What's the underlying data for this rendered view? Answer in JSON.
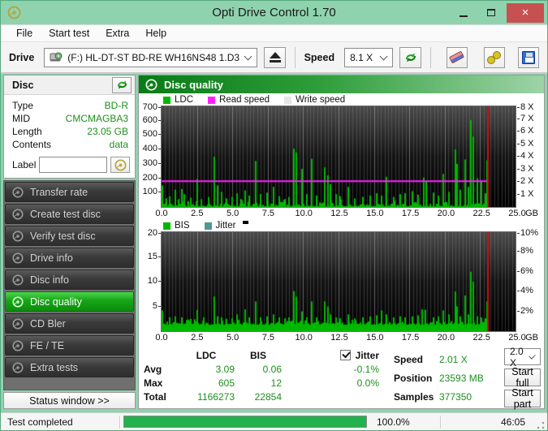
{
  "window": {
    "title": "Opti Drive Control 1.70",
    "close_glyph": "×"
  },
  "menu": {
    "items": [
      {
        "label": "File"
      },
      {
        "label": "Start test"
      },
      {
        "label": "Extra"
      },
      {
        "label": "Help"
      }
    ]
  },
  "toolbar": {
    "drive_label": "Drive",
    "drive_value": "(F:)  HL-DT-ST BD-RE  WH16NS48 1.D3",
    "speed_label": "Speed",
    "speed_value": "8.1 X"
  },
  "disc_panel": {
    "title": "Disc",
    "rows": [
      {
        "label": "Type",
        "value": "BD-R"
      },
      {
        "label": "MID",
        "value": "CMCMAGBA3"
      },
      {
        "label": "Length",
        "value": "23.05 GB"
      },
      {
        "label": "Contents",
        "value": "data"
      }
    ],
    "label_field": {
      "label": "Label",
      "value": ""
    }
  },
  "sidebar": {
    "buttons": [
      {
        "label": "Transfer rate"
      },
      {
        "label": "Create test disc"
      },
      {
        "label": "Verify test disc"
      },
      {
        "label": "Drive info"
      },
      {
        "label": "Disc info"
      },
      {
        "label": "Disc quality",
        "active": true
      },
      {
        "label": "CD Bler"
      },
      {
        "label": "FE / TE"
      },
      {
        "label": "Extra tests"
      }
    ],
    "status_window_label": "Status window >>"
  },
  "main": {
    "header": "Disc quality"
  },
  "chart_data": [
    {
      "type": "bar",
      "title": "Disc quality - LDC",
      "legend": [
        "LDC",
        "Read speed",
        "Write speed"
      ],
      "legend_colors": [
        "#00b800",
        "#ff22ff",
        "#e6e6e6"
      ],
      "xlim": [
        0,
        25
      ],
      "x_ticks": [
        "0.0",
        "2.5",
        "5.0",
        "7.5",
        "10.0",
        "12.5",
        "15.0",
        "17.5",
        "20.0",
        "22.5",
        "25.0"
      ],
      "x_unit": "GB",
      "ylim_left": [
        0,
        700
      ],
      "y_ticks_left": [
        "700",
        "600",
        "500",
        "400",
        "300",
        "200",
        "100"
      ],
      "ylim_right": [
        0,
        8
      ],
      "y_ticks_right": [
        "8 X",
        "7 X",
        "6 X",
        "5 X",
        "4 X",
        "3 X",
        "2 X",
        "1 X"
      ],
      "grid_step_gb": 0.25,
      "read_speed_x": 2.05,
      "marker_gb": 23.05,
      "data_end_gb": 23.05,
      "noise": {
        "base": 3,
        "max": 55,
        "seed": 11
      },
      "spikes": [
        [
          0.08,
          150
        ],
        [
          0.35,
          60
        ],
        [
          0.55,
          75
        ],
        [
          0.95,
          120
        ],
        [
          1.2,
          55
        ],
        [
          1.45,
          125
        ],
        [
          1.6,
          90
        ],
        [
          2.05,
          65
        ],
        [
          2.55,
          195
        ],
        [
          2.8,
          55
        ],
        [
          3.3,
          70
        ],
        [
          3.75,
          350
        ],
        [
          3.95,
          150
        ],
        [
          4.25,
          105
        ],
        [
          4.6,
          60
        ],
        [
          5.0,
          70
        ],
        [
          5.35,
          95
        ],
        [
          5.6,
          55
        ],
        [
          5.9,
          115
        ],
        [
          6.2,
          80
        ],
        [
          6.65,
          320
        ],
        [
          7.0,
          90
        ],
        [
          7.45,
          100
        ],
        [
          7.9,
          140
        ],
        [
          8.3,
          75
        ],
        [
          8.7,
          55
        ],
        [
          9.0,
          70
        ],
        [
          9.35,
          405
        ],
        [
          9.5,
          380
        ],
        [
          9.9,
          265
        ],
        [
          10.25,
          90
        ],
        [
          10.6,
          335
        ],
        [
          10.95,
          80
        ],
        [
          11.55,
          275
        ],
        [
          11.75,
          220
        ],
        [
          11.95,
          160
        ],
        [
          12.3,
          90
        ],
        [
          12.6,
          75
        ],
        [
          13.2,
          140
        ],
        [
          13.65,
          60
        ],
        [
          14.2,
          70
        ],
        [
          14.75,
          80
        ],
        [
          15.2,
          95
        ],
        [
          15.55,
          80
        ],
        [
          15.9,
          210
        ],
        [
          16.4,
          70
        ],
        [
          16.85,
          90
        ],
        [
          17.2,
          95
        ],
        [
          17.7,
          110
        ],
        [
          18.1,
          85
        ],
        [
          18.5,
          205
        ],
        [
          18.7,
          180
        ],
        [
          19.2,
          100
        ],
        [
          19.55,
          80
        ],
        [
          19.9,
          230
        ],
        [
          20.3,
          105
        ],
        [
          20.75,
          400
        ],
        [
          20.9,
          300
        ],
        [
          21.1,
          120
        ],
        [
          21.45,
          330
        ],
        [
          21.7,
          140
        ],
        [
          21.87,
          605
        ],
        [
          22.0,
          490
        ],
        [
          22.3,
          200
        ],
        [
          22.6,
          175
        ],
        [
          22.85,
          95
        ],
        [
          23.0,
          325
        ]
      ]
    },
    {
      "type": "bar",
      "title": "Disc quality - BIS / Jitter",
      "legend": [
        "BIS",
        "Jitter"
      ],
      "legend_colors": [
        "#00b800",
        "#4f9696"
      ],
      "xlim": [
        0,
        25
      ],
      "x_ticks": [
        "0.0",
        "2.5",
        "5.0",
        "7.5",
        "10.0",
        "12.5",
        "15.0",
        "17.5",
        "20.0",
        "22.5",
        "25.0"
      ],
      "x_unit": "GB",
      "ylim_left": [
        0,
        20
      ],
      "y_ticks_left": [
        "20",
        "15",
        "10",
        "5"
      ],
      "ylim_right": [
        0,
        10
      ],
      "y_ticks_right": [
        "10%",
        "8%",
        "6%",
        "4%",
        "2%"
      ],
      "grid_step_gb": 0.25,
      "read_speed_x": null,
      "marker_gb": 23.05,
      "data_end_gb": 23.05,
      "noise": {
        "base": 1.3,
        "max": 2.6,
        "seed": 23
      },
      "spikes": [
        [
          0.08,
          4.2
        ],
        [
          0.55,
          2.8
        ],
        [
          0.95,
          3
        ],
        [
          1.45,
          2.8
        ],
        [
          2.05,
          2.5
        ],
        [
          2.55,
          4.3
        ],
        [
          3.0,
          2.8
        ],
        [
          3.75,
          7
        ],
        [
          3.95,
          3
        ],
        [
          4.25,
          2.8
        ],
        [
          4.6,
          2.5
        ],
        [
          5.0,
          2.6
        ],
        [
          5.35,
          3.4
        ],
        [
          5.9,
          4.4
        ],
        [
          6.2,
          2.8
        ],
        [
          6.65,
          6
        ],
        [
          7.0,
          2.8
        ],
        [
          7.45,
          3
        ],
        [
          7.9,
          3.4
        ],
        [
          8.3,
          2.8
        ],
        [
          8.7,
          2.6
        ],
        [
          9.0,
          2.8
        ],
        [
          9.35,
          8.1
        ],
        [
          9.5,
          7
        ],
        [
          9.9,
          4
        ],
        [
          10.25,
          2.8
        ],
        [
          10.6,
          6
        ],
        [
          10.95,
          2.8
        ],
        [
          11.55,
          6
        ],
        [
          11.75,
          5
        ],
        [
          11.95,
          3.4
        ],
        [
          12.3,
          2.8
        ],
        [
          12.6,
          2.6
        ],
        [
          13.2,
          3.4
        ],
        [
          13.65,
          2.6
        ],
        [
          14.2,
          2.8
        ],
        [
          14.75,
          3
        ],
        [
          15.2,
          3.2
        ],
        [
          15.55,
          4.2
        ],
        [
          15.9,
          3.4
        ],
        [
          16.4,
          2.8
        ],
        [
          16.85,
          3
        ],
        [
          17.2,
          2.8
        ],
        [
          17.7,
          3
        ],
        [
          18.1,
          3.2
        ],
        [
          18.4,
          4.4
        ],
        [
          18.65,
          4.3
        ],
        [
          19.2,
          2.8
        ],
        [
          19.55,
          3
        ],
        [
          19.9,
          4.2
        ],
        [
          20.3,
          3.4
        ],
        [
          20.75,
          8
        ],
        [
          20.9,
          5
        ],
        [
          21.1,
          3
        ],
        [
          21.45,
          7.2
        ],
        [
          21.7,
          3.4
        ],
        [
          21.87,
          12
        ],
        [
          22.0,
          10
        ],
        [
          22.3,
          3
        ],
        [
          22.6,
          2.8
        ],
        [
          22.85,
          2.6
        ],
        [
          23.0,
          6
        ]
      ]
    }
  ],
  "stats": {
    "col_ldc": "LDC",
    "col_bis": "BIS",
    "jitter_label": "Jitter",
    "avg": {
      "label": "Avg",
      "ldc": "3.09",
      "bis": "0.06",
      "jitter": "-0.1%"
    },
    "max": {
      "label": "Max",
      "ldc": "605",
      "bis": "12",
      "jitter": "0.0%"
    },
    "total": {
      "label": "Total",
      "ldc": "1166273",
      "bis": "22854"
    },
    "speed": {
      "label": "Speed",
      "value": "2.01 X"
    },
    "position": {
      "label": "Position",
      "value": "23593 MB"
    },
    "samples": {
      "label": "Samples",
      "value": "377350"
    },
    "speed_select": "2.0 X",
    "start_full": "Start full",
    "start_part": "Start part"
  },
  "statusbar": {
    "status": "Test completed",
    "progress_label": "100.0%",
    "progress_fraction": 1.0,
    "time": "46:05"
  },
  "colors": {
    "bar_green": "#00b800",
    "read_speed": "#ff22ff",
    "marker_red": "#cc1111",
    "plot_grid": "rgba(150,150,150,0.30)",
    "plot_grid_major": "rgba(185,185,185,0.50)"
  }
}
